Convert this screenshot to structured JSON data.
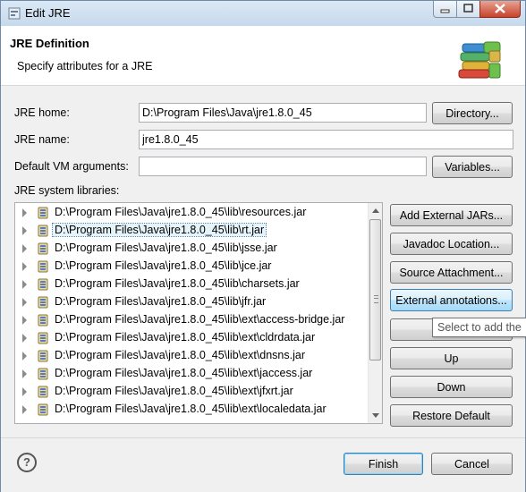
{
  "window": {
    "title": "Edit JRE"
  },
  "header": {
    "title": "JRE Definition",
    "subtitle": "Specify attributes for a JRE"
  },
  "form": {
    "jre_home_label": "JRE home:",
    "jre_home_value": "D:\\Program Files\\Java\\jre1.8.0_45",
    "directory_button": "Directory...",
    "jre_name_label": "JRE name:",
    "jre_name_value": "jre1.8.0_45",
    "vm_args_label": "Default VM arguments:",
    "vm_args_value": "",
    "variables_button": "Variables...",
    "libraries_label": "JRE system libraries:"
  },
  "libraries": [
    "D:\\Program Files\\Java\\jre1.8.0_45\\lib\\resources.jar",
    "D:\\Program Files\\Java\\jre1.8.0_45\\lib\\rt.jar",
    "D:\\Program Files\\Java\\jre1.8.0_45\\lib\\jsse.jar",
    "D:\\Program Files\\Java\\jre1.8.0_45\\lib\\jce.jar",
    "D:\\Program Files\\Java\\jre1.8.0_45\\lib\\charsets.jar",
    "D:\\Program Files\\Java\\jre1.8.0_45\\lib\\jfr.jar",
    "D:\\Program Files\\Java\\jre1.8.0_45\\lib\\ext\\access-bridge.jar",
    "D:\\Program Files\\Java\\jre1.8.0_45\\lib\\ext\\cldrdata.jar",
    "D:\\Program Files\\Java\\jre1.8.0_45\\lib\\ext\\dnsns.jar",
    "D:\\Program Files\\Java\\jre1.8.0_45\\lib\\ext\\jaccess.jar",
    "D:\\Program Files\\Java\\jre1.8.0_45\\lib\\ext\\jfxrt.jar",
    "D:\\Program Files\\Java\\jre1.8.0_45\\lib\\ext\\localedata.jar"
  ],
  "selected_library_index": 1,
  "side_buttons": {
    "add_external_jars": "Add External JARs...",
    "javadoc_location": "Javadoc Location...",
    "source_attachment": "Source Attachment...",
    "external_annotations": "External annotations...",
    "up": "Up",
    "down": "Down",
    "restore_default": "Restore Default"
  },
  "tooltip": "Select to add the",
  "footer": {
    "help": "?",
    "finish": "Finish",
    "cancel": "Cancel"
  },
  "colors": {
    "selection_bg": "#e5f3fb",
    "focus_border": "#3c7fb1",
    "title_gradient_top": "#dbe8f5"
  }
}
